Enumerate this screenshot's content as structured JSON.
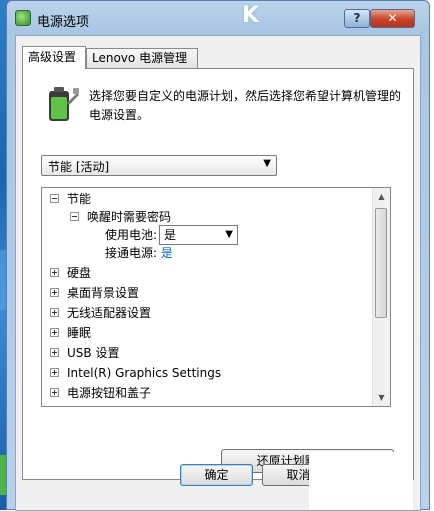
{
  "window": {
    "title": "电源选项",
    "help_label": "?",
    "close_label": "✕",
    "title_deco": "K"
  },
  "tabs": [
    {
      "label": "高级设置",
      "active": true
    },
    {
      "label": "Lenovo 电源管理",
      "active": false
    }
  ],
  "description": "选择您要自定义的电源计划，然后选择您希望计算机管理的电源设置。",
  "plan_select": {
    "value": "节能 [活动]"
  },
  "tree": {
    "items": [
      {
        "label": "节能",
        "expanded": true,
        "level": 0
      },
      {
        "label": "唤醒时需要密码",
        "expanded": true,
        "level": 1
      },
      {
        "label": "使用电池:",
        "value": "是",
        "level": 2,
        "control": "dropdown"
      },
      {
        "label": "接通电源:",
        "value": "是",
        "level": 2,
        "control": "link"
      },
      {
        "label": "硬盘",
        "expanded": false,
        "level": 0
      },
      {
        "label": "桌面背景设置",
        "expanded": false,
        "level": 0
      },
      {
        "label": "无线适配器设置",
        "expanded": false,
        "level": 0
      },
      {
        "label": "睡眠",
        "expanded": false,
        "level": 0
      },
      {
        "label": "USB 设置",
        "expanded": false,
        "level": 0
      },
      {
        "label": "Intel(R) Graphics Settings",
        "expanded": false,
        "level": 0
      },
      {
        "label": "电源按钮和盖子",
        "expanded": false,
        "level": 0
      }
    ]
  },
  "buttons": {
    "restore": "还原计划默认值(R)",
    "ok": "确定",
    "cancel": "取消"
  },
  "colors": {
    "link": "#0066cc",
    "title_bar": "#a9c6e4",
    "close": "#c7432a"
  }
}
